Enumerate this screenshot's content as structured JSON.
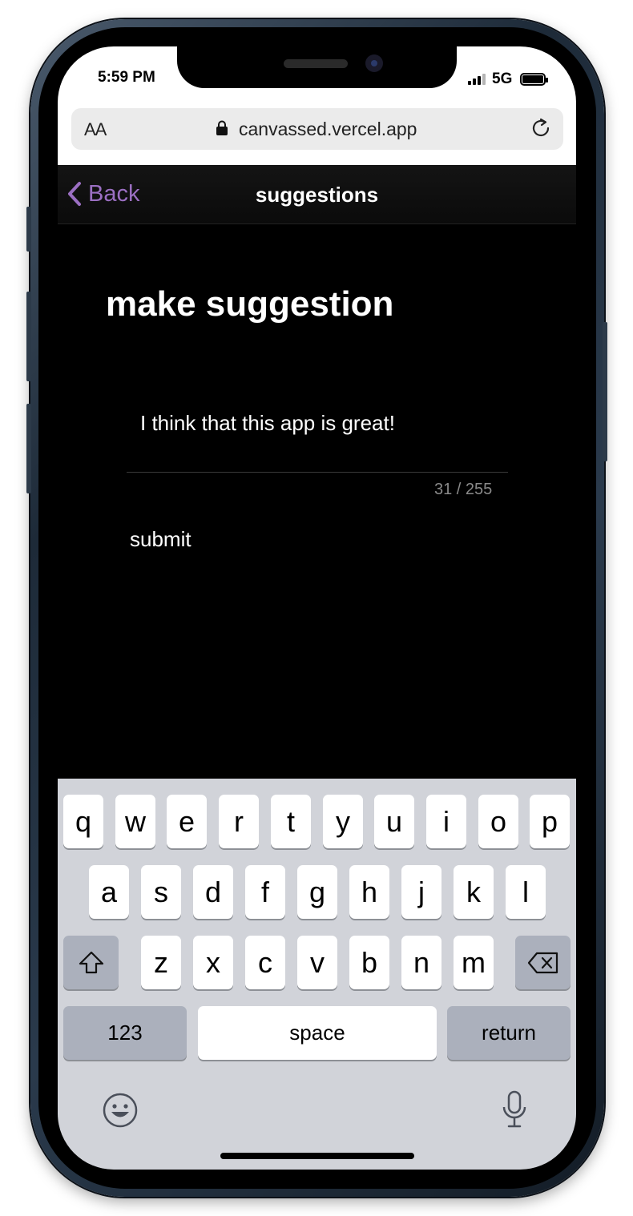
{
  "status": {
    "time": "5:59 PM",
    "network": "5G"
  },
  "browser": {
    "text_size_label": "AA",
    "url": "canvassed.vercel.app"
  },
  "nav": {
    "back_label": "Back",
    "title": "suggestions"
  },
  "form": {
    "heading": "make suggestion",
    "suggestion_value": "I think that this app is great!",
    "char_counter": "31 / 255",
    "submit_label": "submit"
  },
  "keyboard": {
    "row1": [
      "q",
      "w",
      "e",
      "r",
      "t",
      "y",
      "u",
      "i",
      "o",
      "p"
    ],
    "row2": [
      "a",
      "s",
      "d",
      "f",
      "g",
      "h",
      "j",
      "k",
      "l"
    ],
    "row3": [
      "z",
      "x",
      "c",
      "v",
      "b",
      "n",
      "m"
    ],
    "numbers_label": "123",
    "space_label": "space",
    "return_label": "return"
  },
  "colors": {
    "accent": "#9b6fc2",
    "screen_bg": "#000000",
    "keyboard_bg": "#d1d3d9"
  }
}
